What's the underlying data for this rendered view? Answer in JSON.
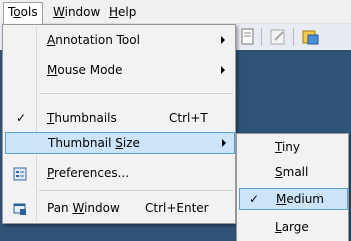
{
  "menubar": {
    "tools": {
      "pre": "T",
      "ul": "o",
      "post": "ols"
    },
    "window": {
      "pre": "",
      "ul": "W",
      "post": "indow"
    },
    "help": {
      "pre": "",
      "ul": "H",
      "post": "elp"
    }
  },
  "tools_menu": {
    "items": [
      {
        "pre": "",
        "ul": "A",
        "post": "nnotation Tool"
      },
      {
        "pre": "",
        "ul": "M",
        "post": "ouse Mode"
      },
      {
        "pre": "",
        "ul": "T",
        "post": "humbnails",
        "shortcut": "Ctrl+T",
        "checked": "✓"
      },
      {
        "pre": "Thumbnail ",
        "ul": "S",
        "post": "ize"
      },
      {
        "pre": "",
        "ul": "P",
        "post": "references..."
      },
      {
        "pre": "Pan ",
        "ul": "W",
        "post": "indow",
        "shortcut": "Ctrl+Enter"
      }
    ]
  },
  "size_menu": {
    "items": [
      {
        "pre": "",
        "ul": "T",
        "post": "iny"
      },
      {
        "pre": "",
        "ul": "S",
        "post": "mall"
      },
      {
        "pre": "",
        "ul": "M",
        "post": "edium",
        "checked": "✓"
      },
      {
        "pre": "",
        "ul": "L",
        "post": "arge"
      }
    ]
  },
  "colors": {
    "highlight": "#cce4f7",
    "highlight_border": "#5aa0d8",
    "menu_bg": "#f2f2f2"
  }
}
